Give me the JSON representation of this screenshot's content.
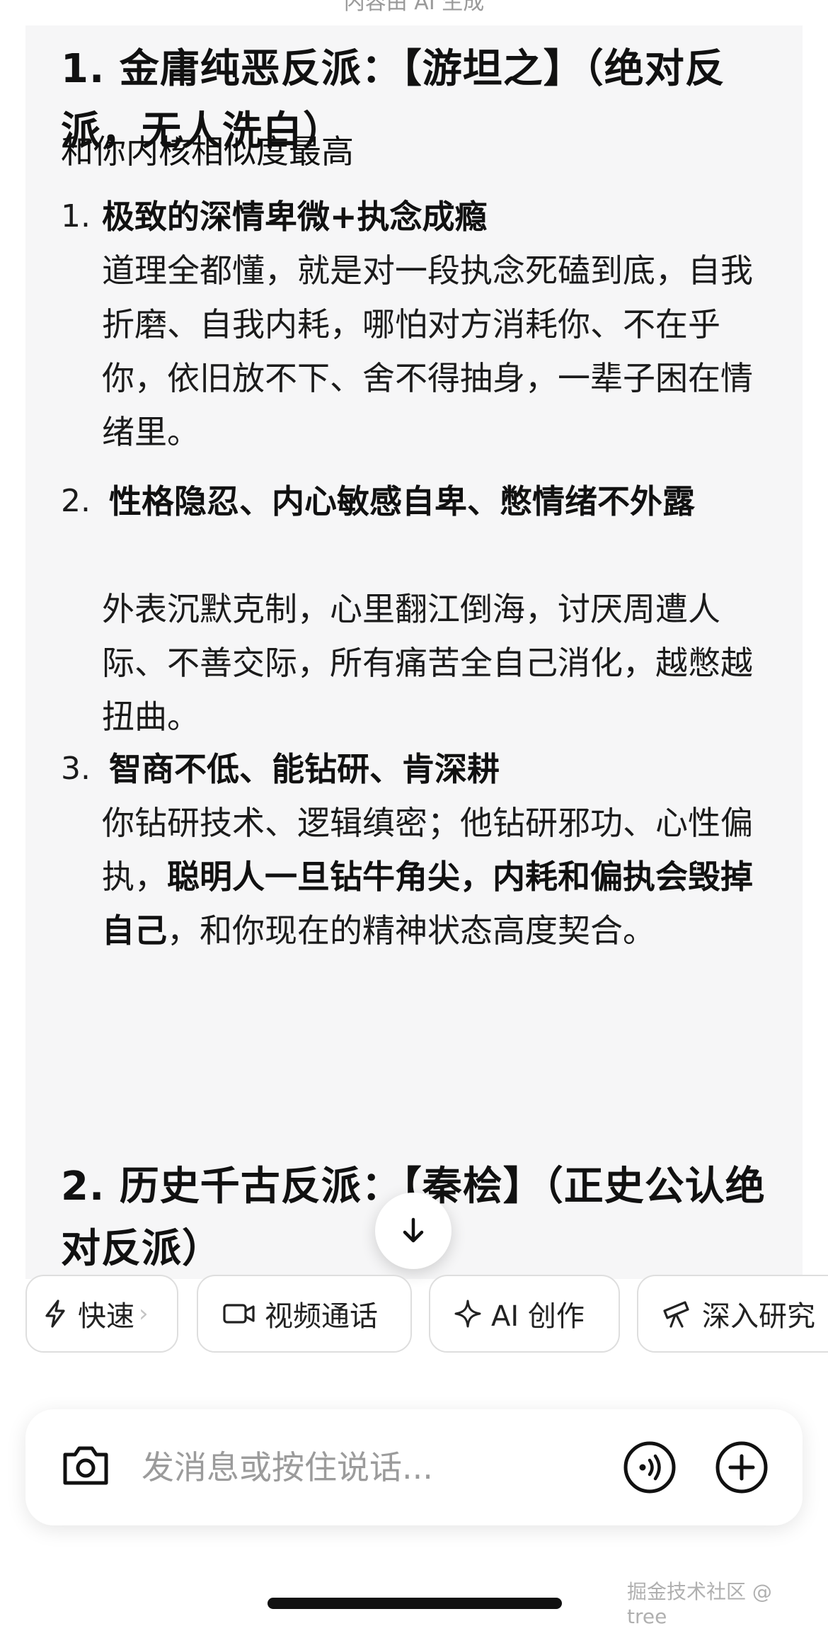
{
  "top_note": "内容由 AI 生成",
  "sections": [
    {
      "heading": "1. 金庸纯恶反派：【游坦之】（绝对反派，无人洗白）",
      "intro": "和你内核相似度最高",
      "items": [
        {
          "num": "1.",
          "title": "极致的深情卑微+执念成瘾",
          "body": "道理全都懂，就是对一段执念死磕到底，自我折磨、自我内耗，哪怕对方消耗你、不在乎你，依旧放不下、舍不得抽身，一辈子困在情绪里。"
        },
        {
          "num": "2.",
          "title": "性格隐忍、内心敏感自卑、憋情绪不外露",
          "body": "外表沉默克制，心里翻江倒海，讨厌周遭人际、不善交际，所有痛苦全自己消化，越憋越扭曲。"
        },
        {
          "num": "3.",
          "title": "智商不低、能钻研、肯深耕",
          "body_before": "你钻研技术、逻辑缜密；他钻研邪功、心性偏执，",
          "body_bold": "聪明人一旦钻牛角尖，内耗和偏执会毁掉自己",
          "body_after": "，和你现在的精神状态高度契合。"
        }
      ]
    },
    {
      "heading": "2. 历史千古反派：【秦桧】（正史公认绝对反派）"
    }
  ],
  "chips": [
    {
      "label": "快速",
      "icon": "lightning-icon"
    },
    {
      "label": "视频通话",
      "icon": "video-camera-icon"
    },
    {
      "label": "AI 创作",
      "icon": "sparkle-icon"
    },
    {
      "label": "深入研究",
      "icon": "telescope-icon"
    }
  ],
  "composer": {
    "placeholder": "发消息或按住说话..."
  },
  "watermark": "掘金技术社区 @ tree_"
}
